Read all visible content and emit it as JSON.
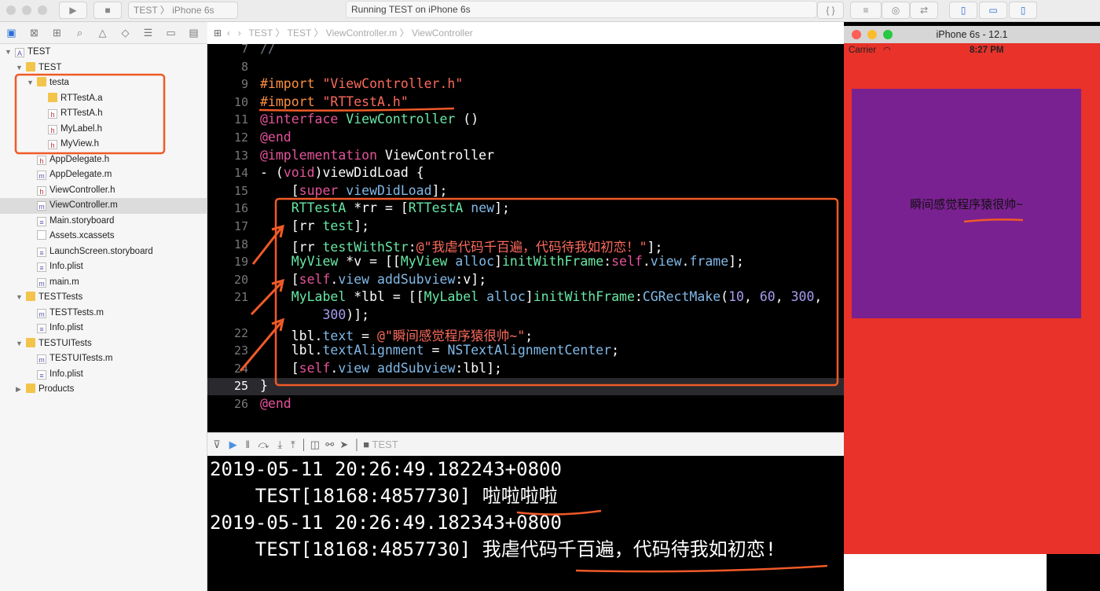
{
  "toolbar": {
    "scheme": "TEST",
    "device": "iPhone 6s",
    "status": "Running TEST on iPhone 6s"
  },
  "jumpbar": {
    "items": [
      "TEST",
      "TEST",
      "ViewController.m",
      "ViewController"
    ]
  },
  "sidebar": {
    "items": [
      {
        "label": "TEST",
        "icon": "project-icon",
        "depth": 0,
        "open": true
      },
      {
        "label": "TEST",
        "icon": "folder-icon",
        "depth": 1,
        "open": true
      },
      {
        "label": "testa",
        "icon": "folder-icon",
        "depth": 2,
        "open": true
      },
      {
        "label": "RTTestA.a",
        "icon": "library-icon",
        "depth": 3
      },
      {
        "label": "RTTestA.h",
        "icon": "h",
        "depth": 3
      },
      {
        "label": "MyLabel.h",
        "icon": "h",
        "depth": 3
      },
      {
        "label": "MyView.h",
        "icon": "h",
        "depth": 3
      },
      {
        "label": "AppDelegate.h",
        "icon": "h",
        "depth": 2
      },
      {
        "label": "AppDelegate.m",
        "icon": "m",
        "depth": 2
      },
      {
        "label": "ViewController.h",
        "icon": "h",
        "depth": 2
      },
      {
        "label": "ViewController.m",
        "icon": "m",
        "depth": 2,
        "selected": true
      },
      {
        "label": "Main.storyboard",
        "icon": "storyboard-icon",
        "depth": 2
      },
      {
        "label": "Assets.xcassets",
        "icon": "assets-icon",
        "depth": 2
      },
      {
        "label": "LaunchScreen.storyboard",
        "icon": "storyboard-icon",
        "depth": 2
      },
      {
        "label": "Info.plist",
        "icon": "plist-icon",
        "depth": 2
      },
      {
        "label": "main.m",
        "icon": "m",
        "depth": 2
      },
      {
        "label": "TESTTests",
        "icon": "folder-icon",
        "depth": 1,
        "open": true
      },
      {
        "label": "TESTTests.m",
        "icon": "m",
        "depth": 2
      },
      {
        "label": "Info.plist",
        "icon": "plist-icon",
        "depth": 2
      },
      {
        "label": "TESTUITests",
        "icon": "folder-icon",
        "depth": 1,
        "open": true
      },
      {
        "label": "TESTUITests.m",
        "icon": "m",
        "depth": 2
      },
      {
        "label": "Info.plist",
        "icon": "plist-icon",
        "depth": 2
      },
      {
        "label": "Products",
        "icon": "folder-icon",
        "depth": 1,
        "open": false
      }
    ]
  },
  "editor": {
    "current_line": "25",
    "lines": [
      {
        "n": "7",
        "html": "<span style='color:#6c7986'>//</span>"
      },
      {
        "n": "8",
        "html": ""
      },
      {
        "n": "9",
        "html": "<span class='pp'>#import </span><span class='s'>\"ViewController.h\"</span>"
      },
      {
        "n": "10",
        "html": "<span class='pp'>#import </span><span class='s'>\"RTTestA.h\"</span>"
      },
      {
        "n": "11",
        "html": "<span class='k'>@interface</span> <span class='t'>ViewController</span> ()"
      },
      {
        "n": "12",
        "html": "<span class='k'>@end</span>"
      },
      {
        "n": "13",
        "html": "<span class='k'>@implementation</span> ViewController"
      },
      {
        "n": "14",
        "html": "- (<span class='k'>void</span>)viewDidLoad {"
      },
      {
        "n": "15",
        "html": "    [<span class='k'>super</span> <span class='f'>viewDidLoad</span>];"
      },
      {
        "n": "16",
        "html": "    <span class='t'>RTTestA</span> *rr = [<span class='t'>RTTestA</span> <span class='f'>new</span>];"
      },
      {
        "n": "17",
        "html": "    [rr <span class='t'>test</span>];"
      },
      {
        "n": "18",
        "html": "    [rr <span class='t'>testWithStr</span>:<span class='s'>@\"我虐代码千百遍，代码待我如初恋！\"</span>];"
      },
      {
        "n": "19",
        "html": "    <span class='t'>MyView</span> *v = [[<span class='t'>MyView</span> <span class='f'>alloc</span>]<span class='t'>initWithFrame</span>:<span class='k'>self</span>.<span class='f'>view</span>.<span class='f'>frame</span>];"
      },
      {
        "n": "20",
        "html": "    [<span class='k'>self</span>.<span class='f'>view</span> <span class='f'>addSubview</span>:v];"
      },
      {
        "n": "21",
        "html": "    <span class='t'>MyLabel</span> *lbl = [[<span class='t'>MyLabel</span> <span class='f'>alloc</span>]<span class='t'>initWithFrame</span>:<span class='f'>CGRectMake</span>(<span class='n'>10</span>, <span class='n'>60</span>, <span class='n'>300</span>,"
      },
      {
        "n": "",
        "html": "        <span class='n'>300</span>)];"
      },
      {
        "n": "22",
        "html": "    lbl.<span class='f'>text</span> = <span class='s'>@\"瞬间感觉程序猿很帅~\"</span>;"
      },
      {
        "n": "23",
        "html": "    lbl.<span class='f'>textAlignment</span> = <span class='f'>NSTextAlignmentCenter</span>;"
      },
      {
        "n": "24",
        "html": "    [<span class='k'>self</span>.<span class='f'>view</span> <span class='f'>addSubview</span>:lbl];"
      },
      {
        "n": "25",
        "html": "}"
      },
      {
        "n": "26",
        "html": "<span class='k'>@end</span>"
      }
    ]
  },
  "debugbar": {
    "target": "TEST"
  },
  "console": {
    "lines": [
      "2019-05-11 20:26:49.182243+0800",
      "    TEST[18168:4857730] 啦啦啦啦",
      "2019-05-11 20:26:49.182343+0800",
      "    TEST[18168:4857730] 我虐代码千百遍，代码待我如初恋!"
    ]
  },
  "simulator": {
    "title": "iPhone 6s - 12.1",
    "carrier": "Carrier",
    "time": "8:27 PM",
    "label": "瞬间感觉程序猿很帅~",
    "screen_color": "#e8322a",
    "view_color": "#7a2191"
  },
  "annotation_color": "#f05a28"
}
